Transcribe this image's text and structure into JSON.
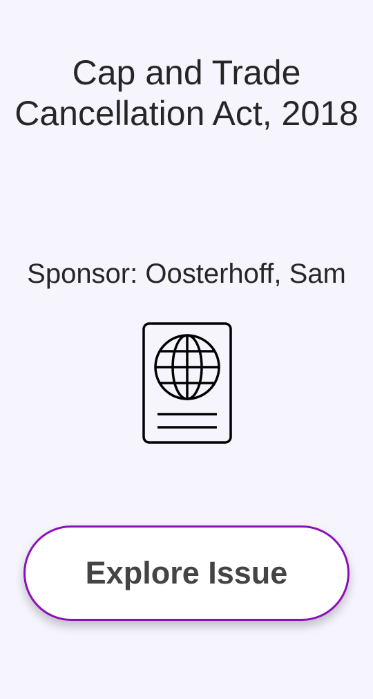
{
  "issue": {
    "title": "Cap and Trade Cancellation Act, 2018",
    "sponsor": "Sponsor: Oosterhoff, Sam",
    "icon": "passport-icon"
  },
  "actions": {
    "explore_label": "Explore Issue"
  },
  "colors": {
    "background": "#f6f5fe",
    "button_border": "#8c10b8",
    "button_fill": "#ffffff",
    "text": "#262626"
  }
}
